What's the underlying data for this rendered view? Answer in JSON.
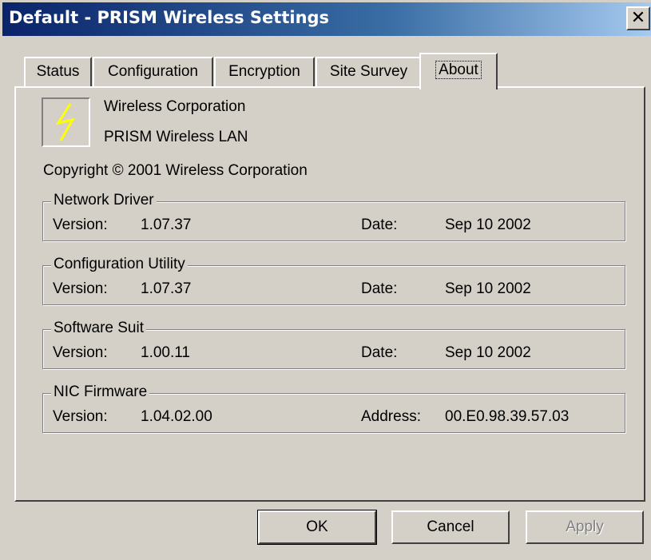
{
  "window": {
    "title": "Default - PRISM Wireless Settings",
    "close_glyph": "✕"
  },
  "tabs": [
    {
      "label": "Status"
    },
    {
      "label": "Configuration"
    },
    {
      "label": "Encryption"
    },
    {
      "label": "Site Survey"
    },
    {
      "label": "About",
      "active": true
    }
  ],
  "about": {
    "logo_icon": "lightning-bolt-icon",
    "company": "Wireless Corporation",
    "product": "PRISM Wireless LAN",
    "copyright": "Copyright © 2001  Wireless Corporation"
  },
  "groups": [
    {
      "title": "Network Driver",
      "version_label": "Version:",
      "version": "1.07.37",
      "right_label": "Date:",
      "right_value": "Sep 10 2002"
    },
    {
      "title": "Configuration Utility",
      "version_label": "Version:",
      "version": "1.07.37",
      "right_label": "Date:",
      "right_value": "Sep 10 2002"
    },
    {
      "title": "Software Suit",
      "version_label": "Version:",
      "version": "1.00.11",
      "right_label": "Date:",
      "right_value": "Sep 10 2002"
    },
    {
      "title": "NIC Firmware",
      "version_label": "Version:",
      "version": "1.04.02.00",
      "right_label": "Address:",
      "right_value": "00.E0.98.39.57.03"
    }
  ],
  "buttons": {
    "ok": "OK",
    "cancel": "Cancel",
    "apply": "Apply"
  },
  "colors": {
    "titlebar_start": "#0a246a",
    "titlebar_end": "#a6caf0",
    "face": "#d4d0c8",
    "bolt": "#ffff00"
  }
}
